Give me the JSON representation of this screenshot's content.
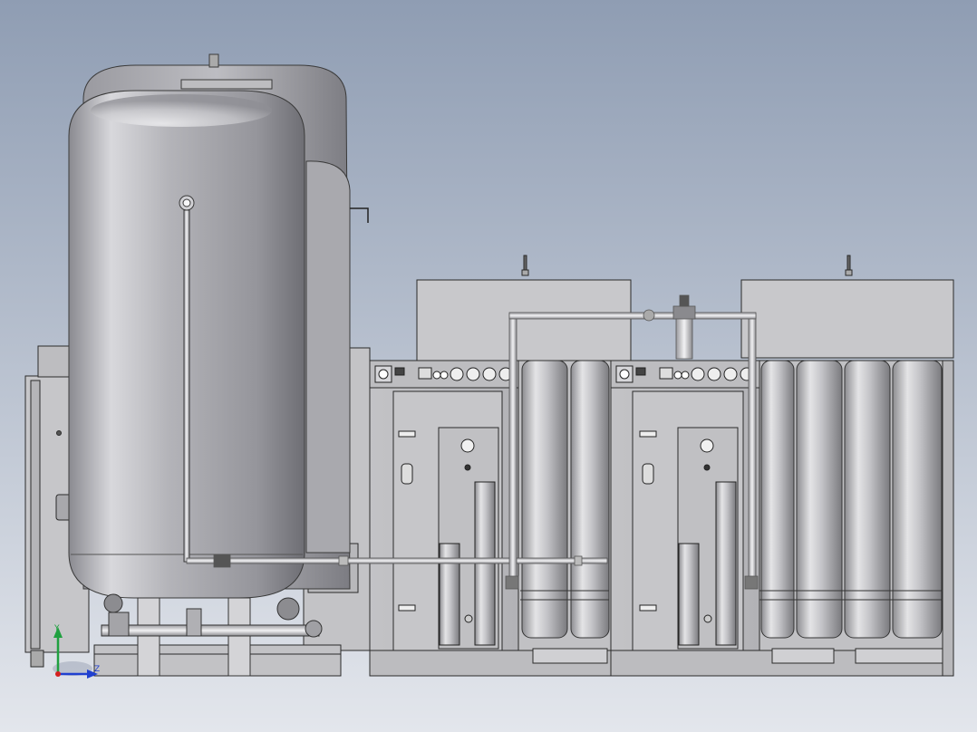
{
  "viewport": {
    "background": {
      "top": "#8f9db3",
      "bottom": "#e3e6ec"
    }
  },
  "triad": {
    "axes": [
      {
        "axis": "x",
        "color": "#d42020"
      },
      {
        "axis": "y",
        "color": "#20a040",
        "label": "Y"
      },
      {
        "axis": "z",
        "color": "#2040d0",
        "label": "Z"
      }
    ]
  },
  "palette": {
    "tank_light": "#f2f2f4",
    "tank_mid": "#b9b9be",
    "tank_dark": "#6e6e74",
    "cabinet": "#c9c9cc",
    "cabinet_edge": "#2a2a2a",
    "pipe": "#dcdcdf"
  },
  "objects": {
    "tank_front": "vertical-air-receiver",
    "tank_back": "vertical-air-receiver",
    "generator_units": 2,
    "adsorption_columns_per_unit": 2,
    "storage_cylinders_right": 4,
    "gauges_per_panel": 4
  }
}
